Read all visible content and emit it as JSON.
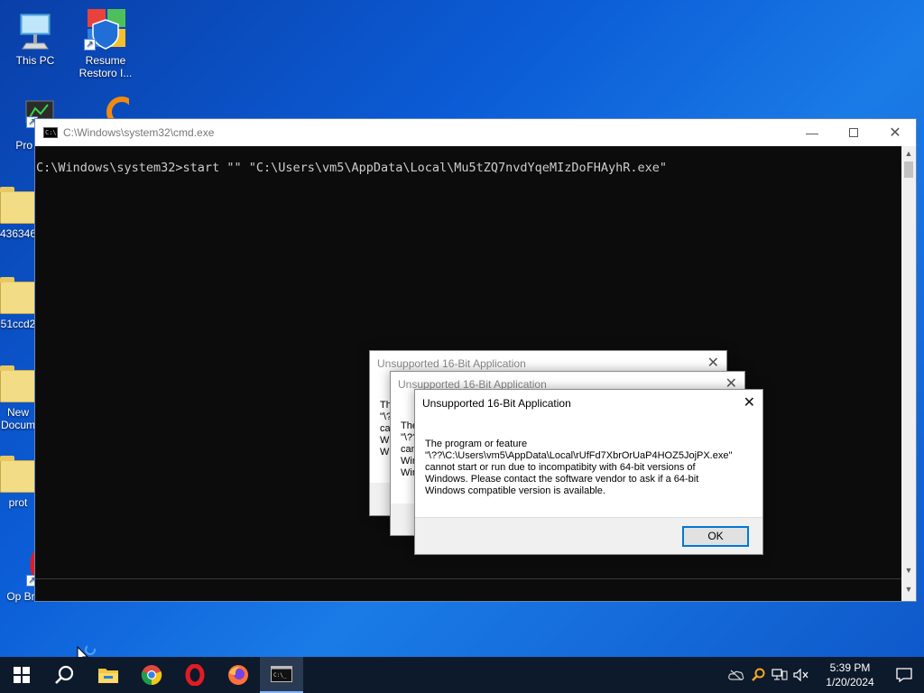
{
  "desktop": {
    "icons": [
      {
        "label": "This PC"
      },
      {
        "label": "Resume Restoro I..."
      },
      {
        "label": "Pro Hac"
      },
      {
        "label": "436346"
      },
      {
        "label": "51ccd2"
      },
      {
        "label": "New Docum"
      },
      {
        "label": "prot"
      },
      {
        "label": "Op Browser"
      }
    ]
  },
  "cmd": {
    "title": "C:\\Windows\\system32\\cmd.exe",
    "console_line": "C:\\Windows\\system32>start \"\" \"C:\\Users\\vm5\\AppData\\Local\\Mu5tZQ7nvdYqeMIzDoFHAyhR.exe\""
  },
  "dialogs": {
    "back_title": "Unsupported 16-Bit Application",
    "mid_title": "Unsupported 16-Bit Application",
    "front": {
      "title": "Unsupported 16-Bit Application",
      "line1": "The program or feature",
      "line2": "\"\\??\\C:\\Users\\vm5\\AppData\\Local\\rUfFd7XbrOrUaP4HOZ5JojPX.exe\"",
      "line3": "cannot start or run due to incompatibity with 64-bit versions of",
      "line4": "Windows. Please contact the software vendor to ask if a 64-bit",
      "line5": "Windows compatible version is available.",
      "ok_label": "OK"
    },
    "partial_back": [
      "Th",
      "\"\\?",
      "ca",
      "Wi",
      "Wi"
    ],
    "partial_mid": [
      "The",
      "\"\\??",
      "can",
      "Win",
      "Win"
    ]
  },
  "taskbar": {
    "time": "5:39 PM",
    "date": "1/20/2024"
  },
  "colors": {
    "desktop_bg": "#0b5cd6",
    "taskbar_bg": "#0d1a2b",
    "accent": "#0078d7"
  }
}
